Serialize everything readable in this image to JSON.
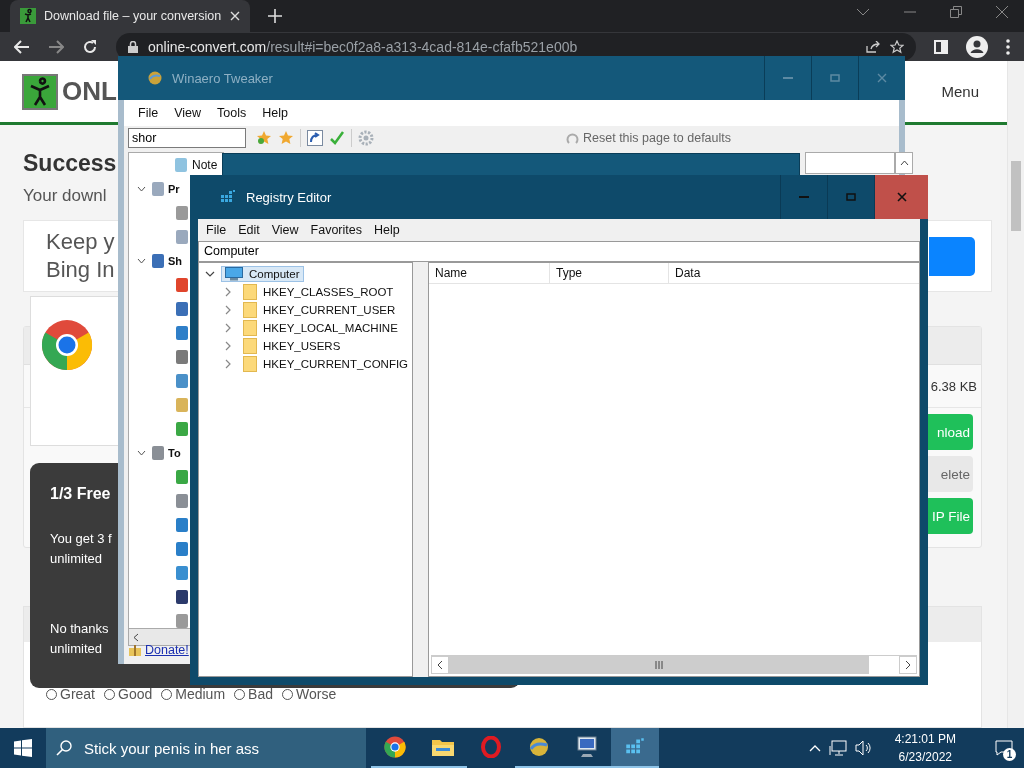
{
  "browser": {
    "tab": {
      "title": "Download file – your conversion"
    },
    "address": {
      "domain": "online-convert.com",
      "path": "/result#i=bec0f2a8-a313-4cad-814e-cfafb521e00b"
    }
  },
  "page": {
    "logo_text": "ONL",
    "menu": "Menu",
    "heading": "Success",
    "subheading": "Your downl",
    "ad_lines": [
      "Keep y",
      "Bing In"
    ],
    "file_size": "6.38 KB",
    "buttons": [
      {
        "label": "nload",
        "kind": "primary"
      },
      {
        "label": "elete",
        "kind": "secondary"
      },
      {
        "label": "IP File",
        "kind": "primary"
      }
    ],
    "popup": {
      "title": "1/3 Free",
      "paragraphs": [
        [
          "You get 3 f",
          "unlimited"
        ],
        [
          "No thanks",
          "unlimited"
        ]
      ]
    },
    "rating": [
      {
        "label": "Great",
        "selected": false
      },
      {
        "label": "Good",
        "selected": false
      },
      {
        "label": "Medium",
        "selected": false
      },
      {
        "label": "Bad",
        "selected": false
      },
      {
        "label": "Worse",
        "selected": false
      }
    ]
  },
  "winaero": {
    "title": "Winaero Tweaker",
    "menu": [
      "File",
      "View",
      "Tools",
      "Help"
    ],
    "search": "shor",
    "reset": "Reset this page to defaults",
    "tree": [
      {
        "label": "Note",
        "kind": "leaf",
        "color": "#8fc3e0"
      },
      {
        "label": "Pr",
        "kind": "group",
        "expanded": true,
        "color": "#9aa9bd",
        "children": [
          {
            "color": "#9a9a9a"
          },
          {
            "color": "#9aa9bd"
          }
        ]
      },
      {
        "label": "Sh",
        "kind": "group",
        "expanded": true,
        "color": "#3b6fb6",
        "children": [
          {
            "color": "#e0452c"
          },
          {
            "color": "#3b6fb6"
          },
          {
            "color": "#2f7fc8"
          },
          {
            "color": "#7a7a7a"
          },
          {
            "color": "#4a90c8"
          },
          {
            "color": "#d9b45a"
          },
          {
            "color": "#3ba845"
          }
        ]
      },
      {
        "label": "To",
        "kind": "group",
        "expanded": true,
        "color": "#8a8f96",
        "children": [
          {
            "color": "#3aa845"
          },
          {
            "color": "#8a8f96"
          },
          {
            "color": "#2a7fc8"
          },
          {
            "color": "#2a7fc8"
          },
          {
            "color": "#3a8fd0"
          },
          {
            "color": "#2b3a6b"
          },
          {
            "color": "#9a9a9a"
          }
        ]
      }
    ],
    "donate": "Donate!"
  },
  "regedit": {
    "title": "Registry Editor",
    "menu": [
      "File",
      "Edit",
      "View",
      "Favorites",
      "Help"
    ],
    "address": "Computer",
    "tree": {
      "label": "Computer",
      "expanded": true,
      "selected": true,
      "children": [
        {
          "label": "HKEY_CLASSES_ROOT",
          "expanded": false,
          "selected": false
        },
        {
          "label": "HKEY_CURRENT_USER",
          "expanded": false,
          "selected": false
        },
        {
          "label": "HKEY_LOCAL_MACHINE",
          "expanded": false,
          "selected": false
        },
        {
          "label": "HKEY_USERS",
          "expanded": false,
          "selected": false
        },
        {
          "label": "HKEY_CURRENT_CONFIG",
          "expanded": false,
          "selected": false
        }
      ]
    },
    "columns": [
      "Name",
      "Type",
      "Data"
    ]
  },
  "taskbar": {
    "search": "Stick your penis in her ass",
    "apps": [
      {
        "kind": "chrome",
        "running": true,
        "selected": false
      },
      {
        "kind": "folder",
        "running": true,
        "selected": false
      },
      {
        "kind": "opera",
        "running": false,
        "selected": false
      },
      {
        "kind": "winaero",
        "running": true,
        "selected": false
      },
      {
        "kind": "monitor",
        "running": true,
        "selected": false
      },
      {
        "kind": "regedit",
        "running": true,
        "selected": true
      }
    ],
    "time": "4:21:01 PM",
    "date": "6/23/2022",
    "notifications": "1"
  }
}
